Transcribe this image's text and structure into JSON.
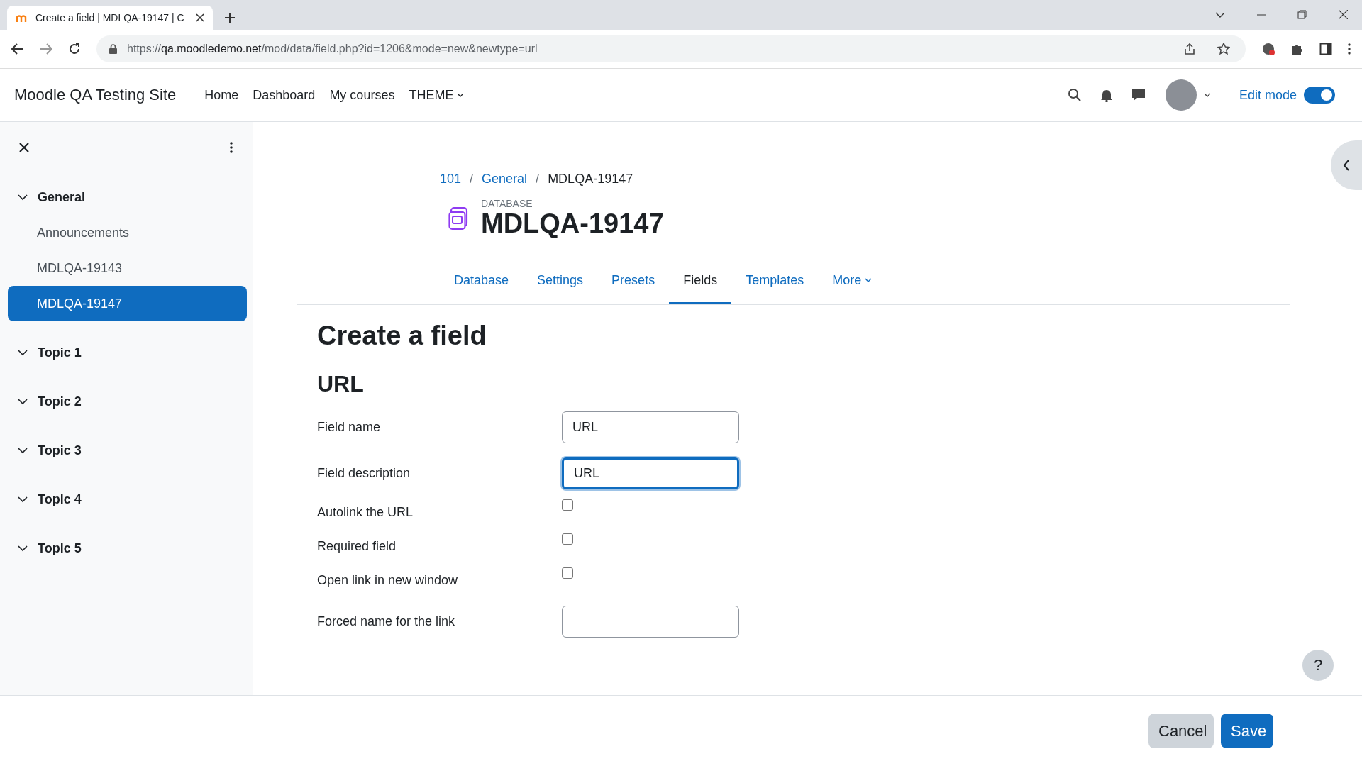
{
  "browser": {
    "tab_title": "Create a field | MDLQA-19147 | C",
    "url_host": "qa.moodledemo.net",
    "url_rest": "/mod/data/field.php?id=1206&mode=new&newtype=url",
    "url_scheme": "https://"
  },
  "navbar": {
    "site_name": "Moodle QA Testing Site",
    "links": [
      {
        "label": "Home",
        "dropdown": false
      },
      {
        "label": "Dashboard",
        "dropdown": false
      },
      {
        "label": "My courses",
        "dropdown": false
      },
      {
        "label": "THEME",
        "dropdown": true
      }
    ],
    "edit_mode": {
      "label": "Edit mode",
      "on": true
    }
  },
  "sidebar": {
    "sections": [
      {
        "title": "General",
        "children": [
          {
            "label": "Announcements",
            "selected": false
          },
          {
            "label": "MDLQA-19143",
            "selected": false
          },
          {
            "label": "MDLQA-19147",
            "selected": true
          }
        ]
      },
      {
        "title": "Topic 1"
      },
      {
        "title": "Topic 2"
      },
      {
        "title": "Topic 3"
      },
      {
        "title": "Topic 4"
      },
      {
        "title": "Topic 5"
      }
    ]
  },
  "breadcrumb": [
    {
      "label": "101",
      "link": true
    },
    {
      "separator": "/",
      "label": "General",
      "link": true
    },
    {
      "separator": "/",
      "label": "MDLQA-19147",
      "link": false
    }
  ],
  "activity": {
    "type_label": "DATABASE",
    "title": "MDLQA-19147"
  },
  "tabs": [
    {
      "label": "Database",
      "selected": false,
      "dropdown": false
    },
    {
      "label": "Settings",
      "selected": false,
      "dropdown": false
    },
    {
      "label": "Presets",
      "selected": false,
      "dropdown": false
    },
    {
      "label": "Fields",
      "selected": true,
      "dropdown": false
    },
    {
      "label": "Templates",
      "selected": false,
      "dropdown": false
    },
    {
      "label": "More",
      "selected": false,
      "dropdown": true
    }
  ],
  "page_heading": "Create a field",
  "section_heading": "URL",
  "form": [
    {
      "kind": "text",
      "label": "Field name",
      "value": "URL",
      "focused": false
    },
    {
      "kind": "text",
      "label": "Field description",
      "value": "URL",
      "focused": true
    },
    {
      "kind": "checkbox",
      "label": "Autolink the URL",
      "checked": false
    },
    {
      "kind": "checkbox",
      "label": "Required field",
      "checked": false
    },
    {
      "kind": "checkbox",
      "label": "Open link in new window",
      "checked": false
    },
    {
      "kind": "text",
      "label": "Forced name for the link",
      "focused": false
    }
  ],
  "help_button": "?",
  "footer_buttons": [
    {
      "label": "Cancel",
      "kind": "secondary"
    },
    {
      "label": "Save",
      "kind": "primary"
    }
  ]
}
